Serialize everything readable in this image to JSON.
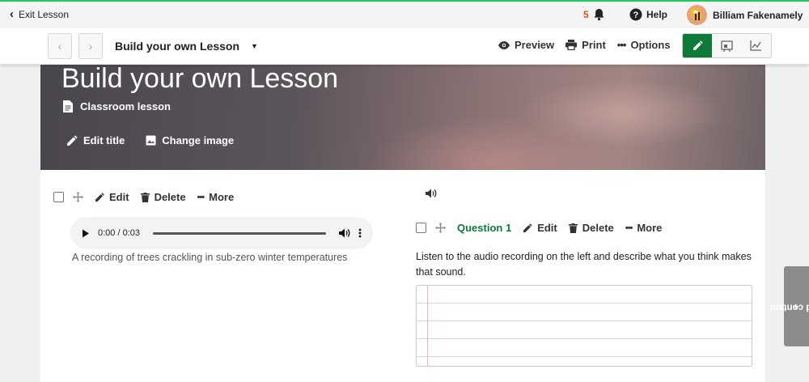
{
  "topbar": {
    "exit_label": "Exit Lesson",
    "notifications_count": "5",
    "help_label": "Help",
    "user_name": "Billiam Fakenamely"
  },
  "toolbar": {
    "lesson_title": "Build your own Lesson",
    "preview_label": "Preview",
    "print_label": "Print",
    "options_label": "Options",
    "active_mode": "edit",
    "accent_color": "#0e7a3a"
  },
  "hero": {
    "title": "Build your own Lesson",
    "lesson_type": "Classroom lesson",
    "edit_title_label": "Edit title",
    "change_image_label": "Change image"
  },
  "audio_block": {
    "edit_label": "Edit",
    "delete_label": "Delete",
    "more_label": "More",
    "time_display": "0:00 / 0:03",
    "caption": "A recording of trees crackling in sub-zero winter temperatures"
  },
  "question_block": {
    "question_label": "Question 1",
    "edit_label": "Edit",
    "delete_label": "Delete",
    "more_label": "More",
    "question_text": "Listen to the audio recording on the left and describe what you think makes that sound."
  },
  "side_tab": {
    "label": "Add content"
  }
}
